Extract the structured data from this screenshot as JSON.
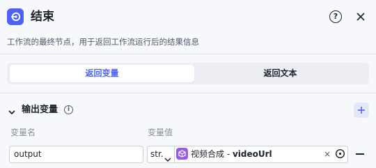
{
  "header": {
    "title": "结束",
    "help_glyph": "?",
    "icon": "end-node-icon"
  },
  "description": "工作流的最终节点，用于返回工作流运行后的结果信息",
  "segment": {
    "options": [
      {
        "label": "返回变量",
        "active": true
      },
      {
        "label": "返回文本",
        "active": false
      }
    ]
  },
  "output_section": {
    "title": "输出变量",
    "info_glyph": "i",
    "columns": {
      "name": "变量名",
      "value": "变量值"
    },
    "rows": [
      {
        "name": "output",
        "type": "str.",
        "ref_node": "视频合成",
        "ref_separator": " - ",
        "ref_var": "videoUrl",
        "clear_glyph": "×"
      }
    ]
  },
  "colors": {
    "accent": "#4e63f6",
    "ref_icon": "#9b59e8",
    "background": "#f7f8fb"
  }
}
